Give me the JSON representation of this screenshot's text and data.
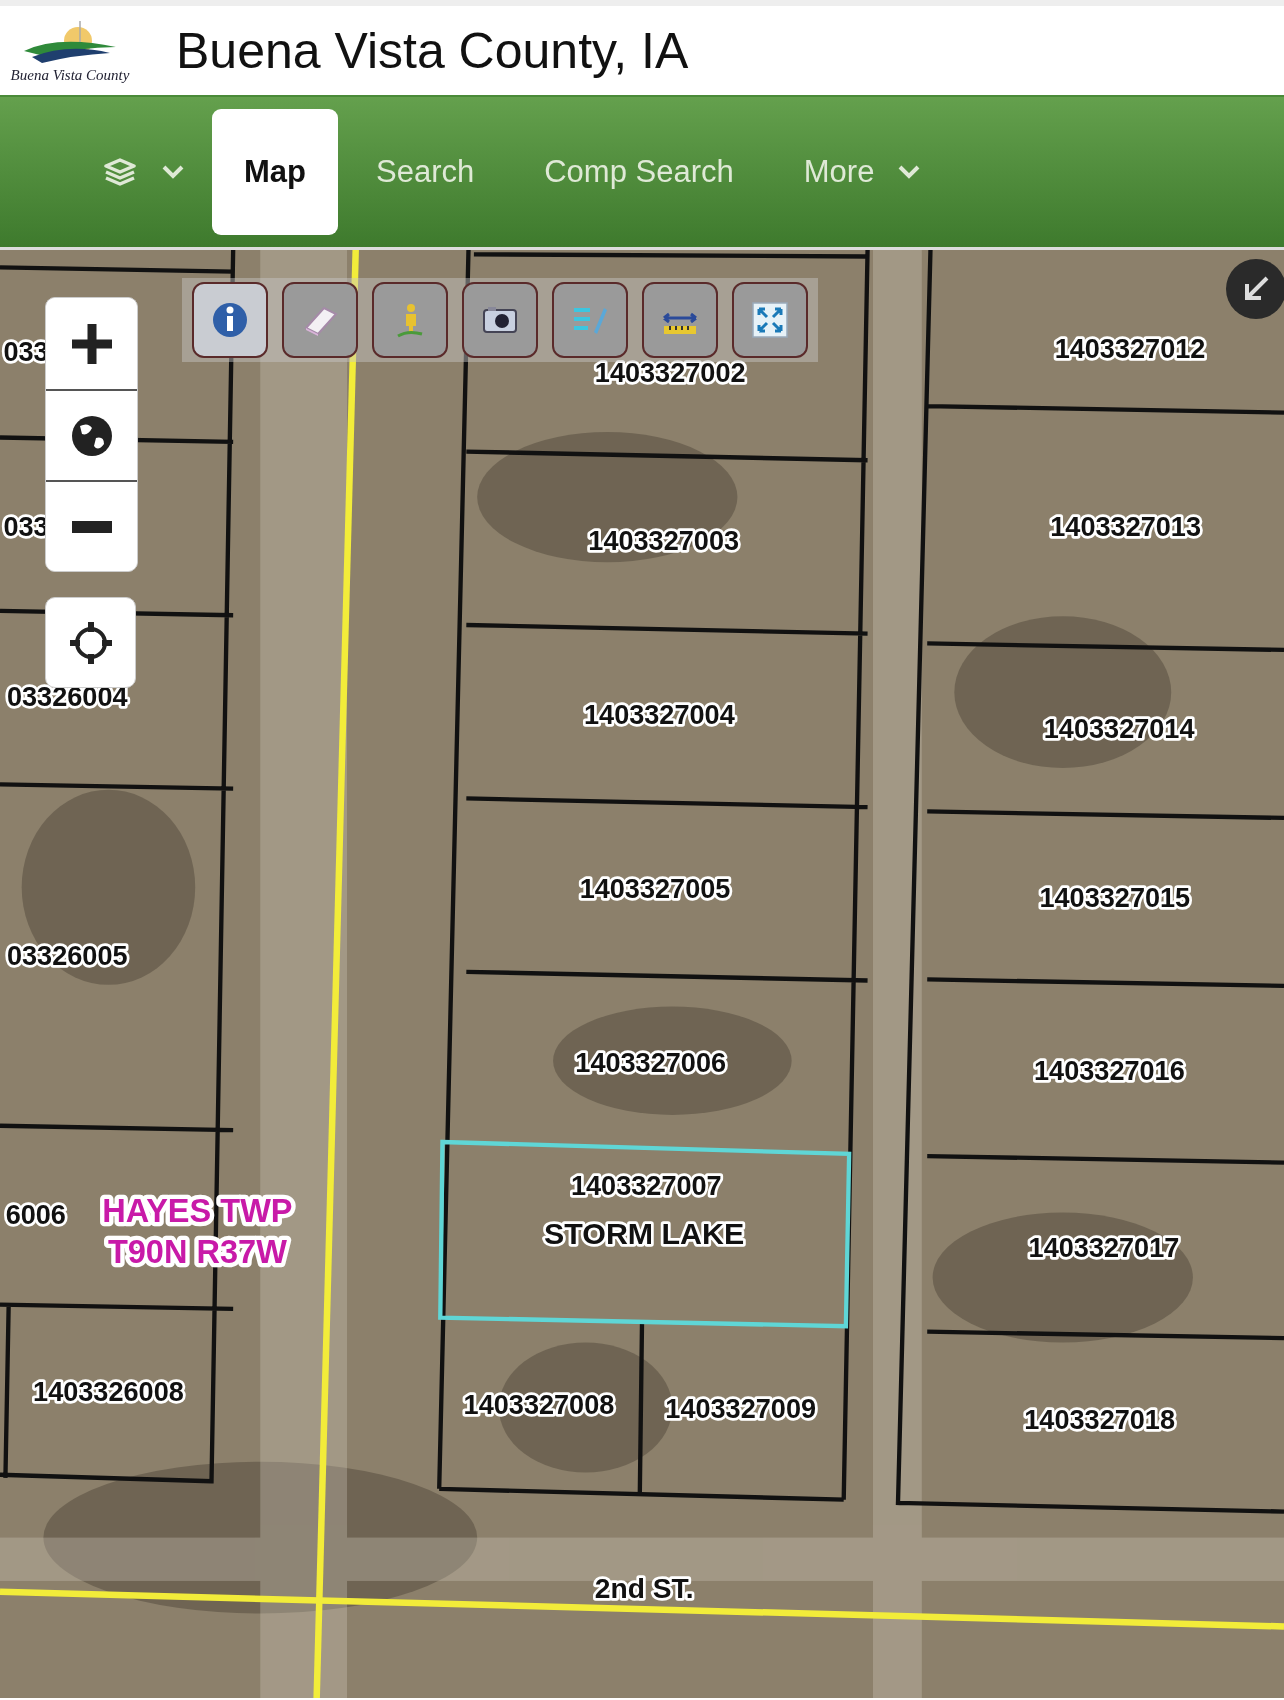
{
  "header": {
    "logo_text": "Buena Vista County",
    "title": "Buena Vista County, IA"
  },
  "nav": {
    "tabs": [
      {
        "label": "Map",
        "selected": true,
        "kind": "page"
      },
      {
        "label": "Search",
        "selected": false,
        "kind": "page"
      },
      {
        "label": "Comp Search",
        "selected": false,
        "kind": "page"
      },
      {
        "label": "More",
        "selected": false,
        "kind": "menu"
      }
    ]
  },
  "map": {
    "labels": [
      {
        "text": "033",
        "kind": "parcel",
        "selected": false
      },
      {
        "text": "1403327012",
        "kind": "parcel",
        "selected": false
      },
      {
        "text": "1403327002",
        "kind": "parcel",
        "selected": false
      },
      {
        "text": "033",
        "kind": "parcel",
        "selected": false
      },
      {
        "text": "1403327003",
        "kind": "parcel",
        "selected": false
      },
      {
        "text": "1403327013",
        "kind": "parcel",
        "selected": false
      },
      {
        "text": "03326004",
        "kind": "parcel",
        "selected": false
      },
      {
        "text": "1403327004",
        "kind": "parcel",
        "selected": false
      },
      {
        "text": "1403327014",
        "kind": "parcel",
        "selected": false
      },
      {
        "text": "1403327005",
        "kind": "parcel",
        "selected": false
      },
      {
        "text": "1403327015",
        "kind": "parcel",
        "selected": false
      },
      {
        "text": "03326005",
        "kind": "parcel",
        "selected": false
      },
      {
        "text": "1403327006",
        "kind": "parcel",
        "selected": false
      },
      {
        "text": "1403327016",
        "kind": "parcel",
        "selected": false
      },
      {
        "text": "1403327007",
        "kind": "parcel",
        "selected": true
      },
      {
        "text": "STORM LAKE",
        "kind": "town"
      },
      {
        "text": "6006",
        "kind": "parcel",
        "selected": false
      },
      {
        "text": "HAYES TWP",
        "kind": "township"
      },
      {
        "text": "T90N R37W",
        "kind": "township"
      },
      {
        "text": "1403327017",
        "kind": "parcel",
        "selected": false
      },
      {
        "text": "1403326008",
        "kind": "parcel",
        "selected": false
      },
      {
        "text": "1403327008",
        "kind": "parcel",
        "selected": false
      },
      {
        "text": "1403327009",
        "kind": "parcel",
        "selected": false
      },
      {
        "text": "1403327018",
        "kind": "parcel",
        "selected": false
      },
      {
        "text": "2nd ST.",
        "kind": "street"
      }
    ]
  }
}
